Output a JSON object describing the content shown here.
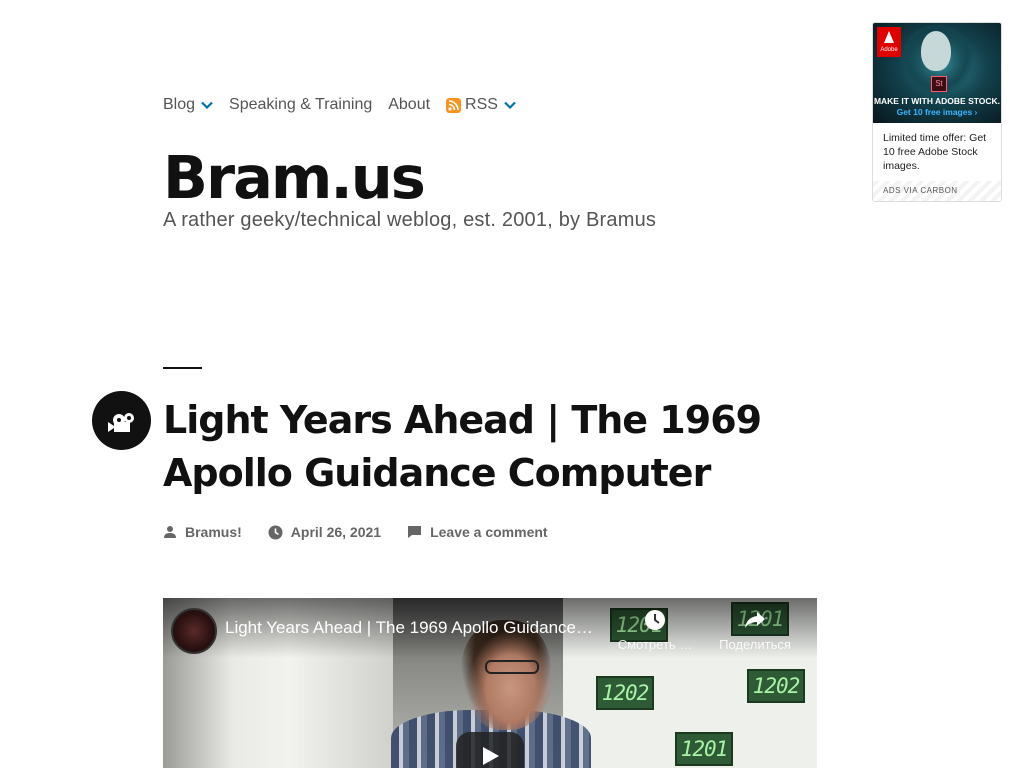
{
  "nav": {
    "items": [
      {
        "label": "Blog",
        "has_dropdown": true
      },
      {
        "label": "Speaking & Training",
        "has_dropdown": false
      },
      {
        "label": "About",
        "has_dropdown": false
      },
      {
        "label": "RSS",
        "has_dropdown": true,
        "icon": "rss-icon"
      }
    ],
    "accent_color": "#0073aa",
    "rss_color": "#f7931e"
  },
  "site": {
    "title": "Bram.us",
    "tagline": "A rather geeky/technical weblog, est. 2001, by Bramus"
  },
  "ad": {
    "brand": "Adobe",
    "product_mark": "St",
    "headline": "MAKE IT WITH ADOBE STOCK.",
    "subheadline": "Get 10 free images ›",
    "text": "Limited time offer: Get 10 free Adobe Stock images.",
    "footer": "ADS VIA CARBON"
  },
  "post": {
    "format_icon": "video-camera-icon",
    "title": "Light Years Ahead | The 1969 Apollo Guidance Computer",
    "meta": {
      "author": "Bramus!",
      "date": "April 26, 2021",
      "comments": "Leave a comment"
    }
  },
  "video": {
    "title": "Light Years Ahead | The 1969 Apollo Guidance…",
    "watch_later_label": "Смотреть …",
    "share_label": "Поделиться",
    "boards": [
      "1201",
      "1201",
      "1202",
      "1202",
      "1201"
    ]
  }
}
